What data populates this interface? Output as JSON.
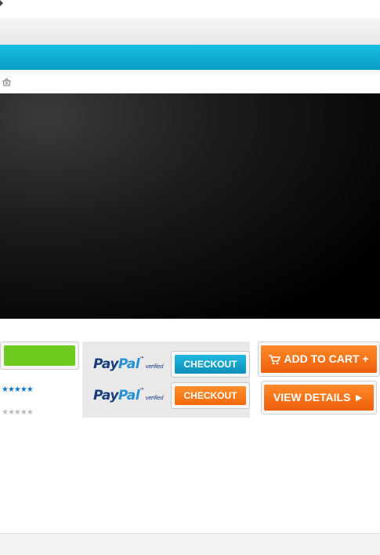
{
  "icons": {
    "caret": "triangle-right-icon",
    "basket": "basket-icon",
    "cart": "shopping-cart-icon",
    "arrow": "play-arrow-icon"
  },
  "colors": {
    "blue_band": "#0fb0d6",
    "green_button": "#6fcb1f",
    "orange_button": "#f26a0c",
    "blue_button": "#1aa6d0",
    "paypal_dark": "#1b3d7e",
    "paypal_light": "#2791d6"
  },
  "ratings": {
    "top_stars": "★★★★★",
    "bottom_stars": "★★★★★",
    "top_rating": 5,
    "bottom_rating": 0
  },
  "paypal": {
    "logo_pay": "Pay",
    "logo_pal": "Pal",
    "tm": "™",
    "verified": "verified",
    "checkout_blue": "CHECKOUT",
    "checkout_orange": "CHECKOUT"
  },
  "buttons": {
    "add_to_cart": "ADD TO CART +",
    "view_details": "VIEW DETAILS ►"
  }
}
